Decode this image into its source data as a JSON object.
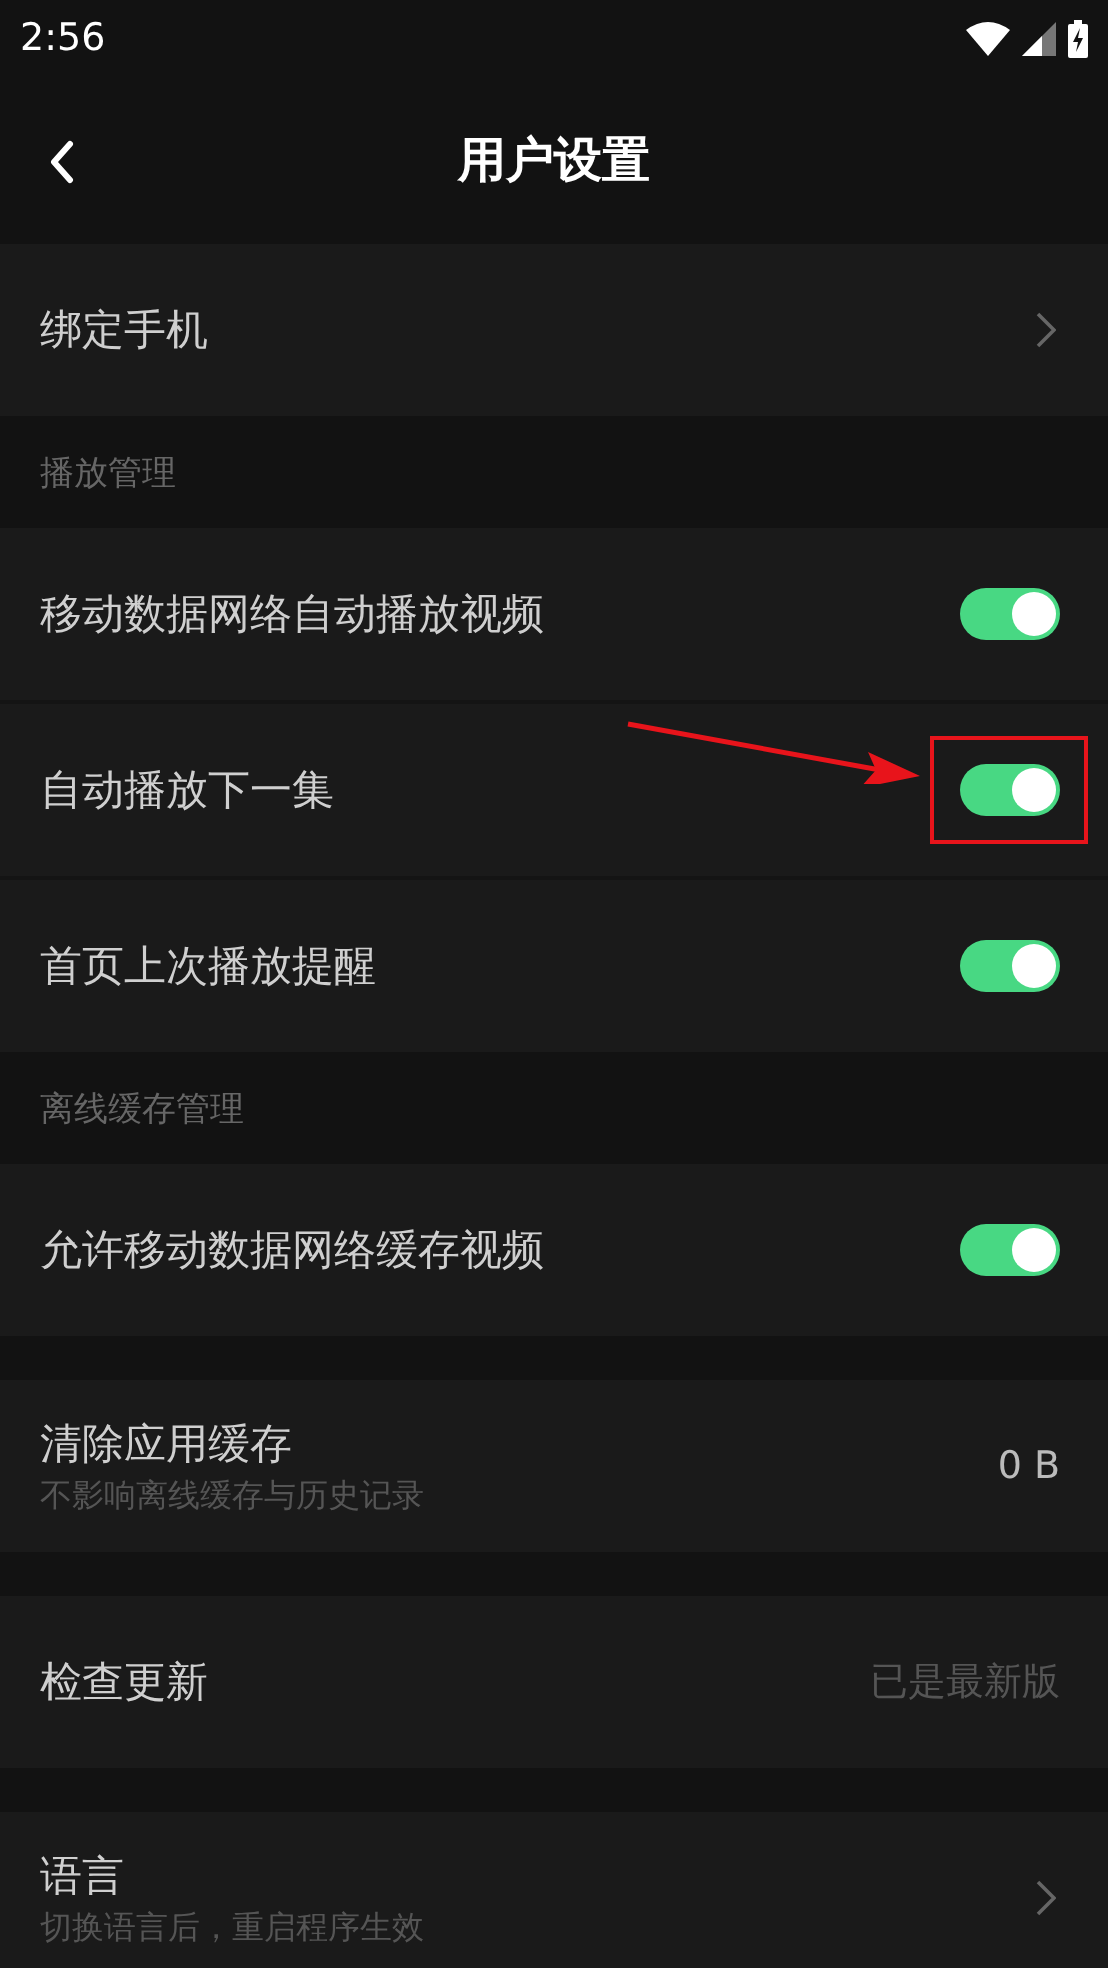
{
  "status_bar": {
    "time": "2:56"
  },
  "header": {
    "title": "用户设置"
  },
  "groups": [
    {
      "rows": [
        {
          "kind": "link",
          "label": "绑定手机",
          "highlighted": false
        }
      ]
    },
    {
      "heading": "播放管理",
      "rows": [
        {
          "kind": "toggle",
          "label": "移动数据网络自动播放视频",
          "on": true,
          "highlighted": false
        },
        {
          "kind": "toggle",
          "label": "自动播放下一集",
          "on": true,
          "highlighted": true
        },
        {
          "kind": "toggle",
          "label": "首页上次播放提醒",
          "on": true,
          "highlighted": false
        }
      ]
    },
    {
      "heading": "离线缓存管理",
      "rows": [
        {
          "kind": "toggle",
          "label": "允许移动数据网络缓存视频",
          "on": true,
          "highlighted": false
        }
      ]
    },
    {
      "rows": [
        {
          "kind": "value",
          "label": "清除应用缓存",
          "subtitle": "不影响离线缓存与历史记录",
          "value": "0 B",
          "dimmed": false,
          "highlighted": false
        }
      ]
    },
    {
      "rows": [
        {
          "kind": "value",
          "label": "检查更新",
          "value": "已是最新版",
          "dimmed": true,
          "highlighted": false
        }
      ]
    },
    {
      "rows": [
        {
          "kind": "link",
          "label": "语言",
          "subtitle": "切换语言后，重启程序生效",
          "highlighted": false
        }
      ]
    }
  ]
}
